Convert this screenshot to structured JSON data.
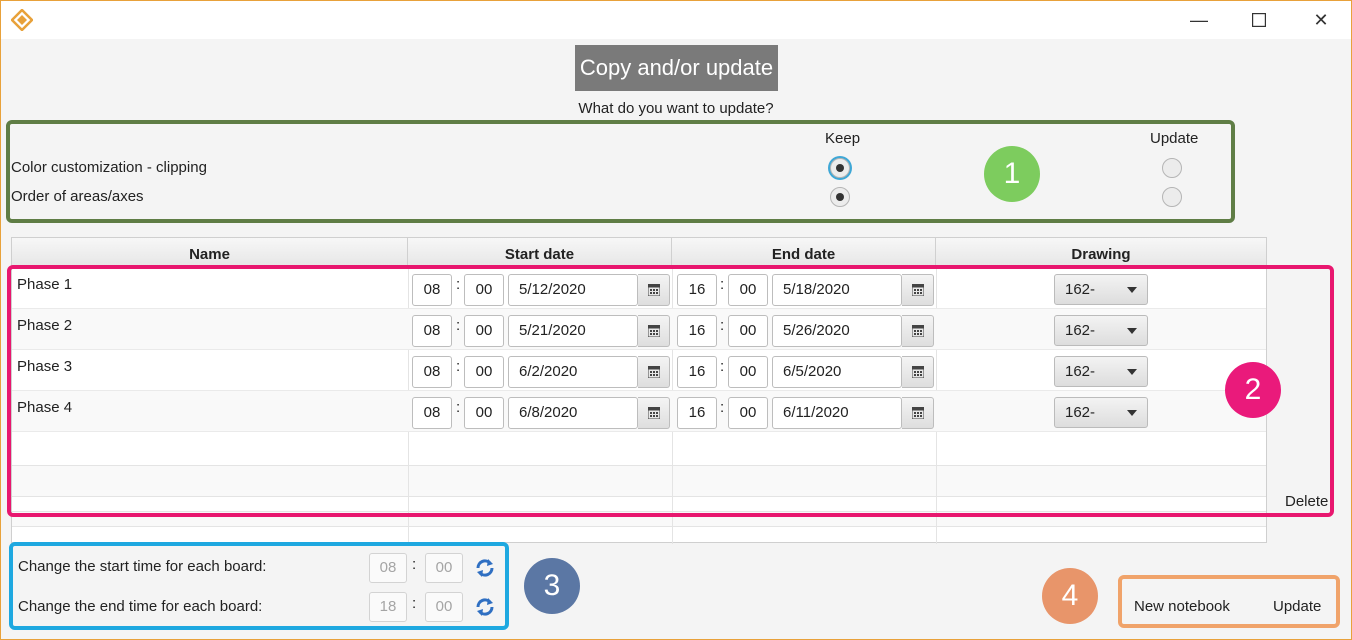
{
  "window": {
    "icon": "app-logo-icon",
    "minimize": "—",
    "maximize": "☐",
    "close": "✕"
  },
  "header": {
    "title_button": "Copy and/or update",
    "question": "What do you want to update?"
  },
  "options": {
    "col_keep": "Keep",
    "col_update": "Update",
    "rows": [
      {
        "label": "Color customization - clipping",
        "selected": "Keep"
      },
      {
        "label": "Order of areas/axes",
        "selected": "Keep"
      }
    ]
  },
  "table": {
    "headers": [
      "Name",
      "Start date",
      "End date",
      "Drawing"
    ],
    "rows": [
      {
        "name": "Phase 1",
        "start_h": "08",
        "start_m": "00",
        "start_date": "5/12/2020",
        "end_h": "16",
        "end_m": "00",
        "end_date": "5/18/2020",
        "drawing": "162-"
      },
      {
        "name": "Phase 2",
        "start_h": "08",
        "start_m": "00",
        "start_date": "5/21/2020",
        "end_h": "16",
        "end_m": "00",
        "end_date": "5/26/2020",
        "drawing": "162-"
      },
      {
        "name": "Phase 3",
        "start_h": "08",
        "start_m": "00",
        "start_date": "6/2/2020",
        "end_h": "16",
        "end_m": "00",
        "end_date": "6/5/2020",
        "drawing": "162-"
      },
      {
        "name": "Phase 4",
        "start_h": "08",
        "start_m": "00",
        "start_date": "6/8/2020",
        "end_h": "16",
        "end_m": "00",
        "end_date": "6/11/2020",
        "drawing": "162-"
      }
    ],
    "delete_label": "Delete"
  },
  "board_times": {
    "start_label": "Change the start time for each board:",
    "start_h": "08",
    "start_m": "00",
    "end_label": "Change the end time for each board:",
    "end_h": "18",
    "end_m": "00"
  },
  "footer": {
    "new_notebook": "New notebook",
    "update": "Update"
  },
  "annotations": {
    "badge_1": "1",
    "badge_2": "2",
    "badge_3": "3",
    "badge_4": "4"
  },
  "colors": {
    "green_box": "#5f7d45",
    "pink_box": "#e8176f",
    "blue_box": "#1ea8e0",
    "orange_box": "#f0a36a",
    "badge_1": "#7dcc5e",
    "badge_2": "#ea1a7b",
    "badge_3": "#5b77a4",
    "badge_4": "#e8956a"
  }
}
